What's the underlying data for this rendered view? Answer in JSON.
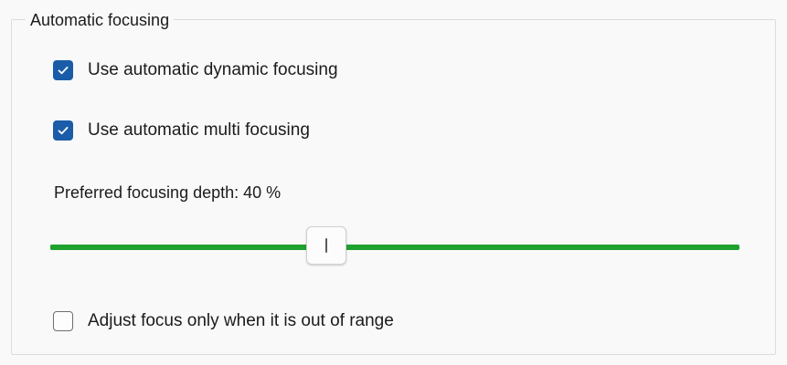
{
  "group": {
    "title": "Automatic focusing"
  },
  "options": {
    "dynamic_focusing": {
      "label": "Use automatic dynamic focusing",
      "checked": true
    },
    "multi_focusing": {
      "label": "Use automatic multi focusing",
      "checked": true
    },
    "adjust_out_of_range": {
      "label": "Adjust focus only when it is out of range",
      "checked": false
    }
  },
  "depth": {
    "label": "Preferred focusing depth: 40 %",
    "value_percent": 40
  },
  "colors": {
    "accent": "#1a5ca8",
    "slider_track": "#1fa12e",
    "background": "#f9f9f9"
  },
  "icons": {
    "checked": "checkmark-icon",
    "thumb": "slider-grip-icon"
  }
}
